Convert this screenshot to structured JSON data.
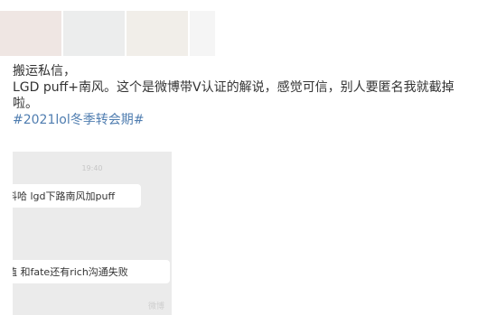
{
  "post": {
    "line1": "搬运私信，",
    "line2": "LGD puff+南风。这个是微博带V认证的解说，感觉可信，别人要匿名我就截掉",
    "line3": "啦。",
    "hashtag": "#2021lol冬季转会期#"
  },
  "screenshot": {
    "time": "19:40",
    "msg1": "料哈 lgd下路南风加puff",
    "msg2": "值  和fate还有rich沟通失败",
    "watermark": "微博"
  },
  "colors": {
    "link": "#4f7db0",
    "chat_background": "#ebebeb",
    "bubble": "#ffffff"
  }
}
